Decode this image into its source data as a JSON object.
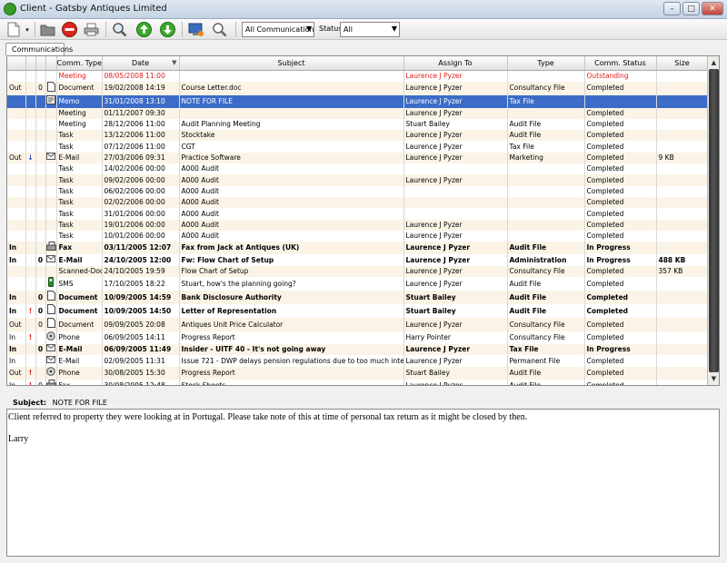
{
  "window": {
    "title": "Client - Gatsby Antiques Limited"
  },
  "toolbar": {
    "filter_value": "All Communications",
    "status_label": "Status",
    "status_value": "All"
  },
  "tabs": [
    {
      "label": "Communications"
    }
  ],
  "grid": {
    "columns": [
      "",
      "",
      "",
      "",
      "Comm. Type",
      "Date",
      "Subject",
      "Assign To",
      "Type",
      "Comm. Status",
      "Size"
    ],
    "rows": [
      {
        "dir": "",
        "flag": "",
        "att": "",
        "icon": "",
        "ctype": "Meeting",
        "date": "08/05/2008 11:00",
        "subject": "",
        "assign": "Laurence J Pyzer",
        "type": "",
        "status": "Outstanding",
        "size": "",
        "style": "red"
      },
      {
        "dir": "Out",
        "flag": "",
        "att": "0",
        "icon": "doc",
        "ctype": "Document",
        "date": "19/02/2008 14:19",
        "subject": "Course Letter.doc",
        "assign": "Laurence J Pyzer",
        "type": "Consultancy File",
        "status": "Completed",
        "size": "",
        "style": ""
      },
      {
        "dir": "",
        "flag": "",
        "att": "",
        "icon": "memo",
        "ctype": "Memo",
        "date": "31/01/2008 13:10",
        "subject": "NOTE FOR FILE",
        "assign": "Laurence J Pyzer",
        "type": "Tax File",
        "status": "",
        "size": "",
        "style": "selected"
      },
      {
        "dir": "",
        "flag": "",
        "att": "",
        "icon": "",
        "ctype": "Meeting",
        "date": "01/11/2007 09:30",
        "subject": "",
        "assign": "Laurence J Pyzer",
        "type": "",
        "status": "Completed",
        "size": "",
        "style": ""
      },
      {
        "dir": "",
        "flag": "",
        "att": "",
        "icon": "",
        "ctype": "Meeting",
        "date": "28/12/2006 11:00",
        "subject": "Audit Planning Meeting",
        "assign": "Stuart Bailey",
        "type": "Audit File",
        "status": "Completed",
        "size": "",
        "style": ""
      },
      {
        "dir": "",
        "flag": "",
        "att": "",
        "icon": "",
        "ctype": "Task",
        "date": "13/12/2006 11:00",
        "subject": "Stocktake",
        "assign": "Laurence J Pyzer",
        "type": "Audit File",
        "status": "Completed",
        "size": "",
        "style": ""
      },
      {
        "dir": "",
        "flag": "",
        "att": "",
        "icon": "",
        "ctype": "Task",
        "date": "07/12/2006 11:00",
        "subject": "CGT",
        "assign": "Laurence J Pyzer",
        "type": "Tax File",
        "status": "Completed",
        "size": "",
        "style": ""
      },
      {
        "dir": "Out",
        "flag": "↓",
        "att": "",
        "icon": "mail",
        "ctype": "E-Mail",
        "date": "27/03/2006 09:31",
        "subject": "Practice Software",
        "assign": "Laurence J Pyzer",
        "type": "Marketing",
        "status": "Completed",
        "size": "9 KB",
        "style": ""
      },
      {
        "dir": "",
        "flag": "",
        "att": "",
        "icon": "",
        "ctype": "Task",
        "date": "14/02/2006 00:00",
        "subject": "A000    Audit",
        "assign": "",
        "type": "",
        "status": "Completed",
        "size": "",
        "style": ""
      },
      {
        "dir": "",
        "flag": "",
        "att": "",
        "icon": "",
        "ctype": "Task",
        "date": "09/02/2006 00:00",
        "subject": "A000    Audit",
        "assign": "Laurence J Pyzer",
        "type": "",
        "status": "Completed",
        "size": "",
        "style": ""
      },
      {
        "dir": "",
        "flag": "",
        "att": "",
        "icon": "",
        "ctype": "Task",
        "date": "06/02/2006 00:00",
        "subject": "A000    Audit",
        "assign": "",
        "type": "",
        "status": "Completed",
        "size": "",
        "style": ""
      },
      {
        "dir": "",
        "flag": "",
        "att": "",
        "icon": "",
        "ctype": "Task",
        "date": "02/02/2006 00:00",
        "subject": "A000    Audit",
        "assign": "",
        "type": "",
        "status": "Completed",
        "size": "",
        "style": ""
      },
      {
        "dir": "",
        "flag": "",
        "att": "",
        "icon": "",
        "ctype": "Task",
        "date": "31/01/2006 00:00",
        "subject": "A000    Audit",
        "assign": "",
        "type": "",
        "status": "Completed",
        "size": "",
        "style": ""
      },
      {
        "dir": "",
        "flag": "",
        "att": "",
        "icon": "",
        "ctype": "Task",
        "date": "19/01/2006 00:00",
        "subject": "A000    Audit",
        "assign": "Laurence J Pyzer",
        "type": "",
        "status": "Completed",
        "size": "",
        "style": ""
      },
      {
        "dir": "",
        "flag": "",
        "att": "",
        "icon": "",
        "ctype": "Task",
        "date": "10/01/2006 00:00",
        "subject": "A000    Audit",
        "assign": "Laurence J Pyzer",
        "type": "",
        "status": "Completed",
        "size": "",
        "style": ""
      },
      {
        "dir": "In",
        "flag": "",
        "att": "",
        "icon": "fax",
        "ctype": "Fax",
        "date": "03/11/2005 12:07",
        "subject": "Fax from Jack at Antiques (UK)",
        "assign": "Laurence J Pyzer",
        "type": "Audit File",
        "status": "In Progress",
        "size": "",
        "style": "bold"
      },
      {
        "dir": "In",
        "flag": "",
        "att": "0",
        "icon": "mail",
        "ctype": "E-Mail",
        "date": "24/10/2005 12:00",
        "subject": "Fw: Flow Chart of Setup",
        "assign": "Laurence J Pyzer",
        "type": "Administration",
        "status": "In Progress",
        "size": "488 KB",
        "style": "bold"
      },
      {
        "dir": "",
        "flag": "",
        "att": "",
        "icon": "",
        "ctype": "Scanned-Doc",
        "date": "24/10/2005 19:59",
        "subject": "Flow Chart of Setup",
        "assign": "Laurence J Pyzer",
        "type": "Consultancy File",
        "status": "Completed",
        "size": "357 KB",
        "style": ""
      },
      {
        "dir": "",
        "flag": "",
        "att": "",
        "icon": "sms",
        "ctype": "SMS",
        "date": "17/10/2005 18:22",
        "subject": "Stuart, how's the planning going?",
        "assign": "Laurence J Pyzer",
        "type": "Audit File",
        "status": "Completed",
        "size": "",
        "style": ""
      },
      {
        "dir": "In",
        "flag": "",
        "att": "0",
        "icon": "doc",
        "ctype": "Document",
        "date": "10/09/2005 14:59",
        "subject": "Bank Disclosure Authority",
        "assign": "Stuart Bailey",
        "type": "Audit File",
        "status": "Completed",
        "size": "",
        "style": "bold"
      },
      {
        "dir": "In",
        "flag": "!",
        "att": "0",
        "icon": "doc",
        "ctype": "Document",
        "date": "10/09/2005 14:50",
        "subject": "Letter of Representation",
        "assign": "Stuart Bailey",
        "type": "Audit File",
        "status": "Completed",
        "size": "",
        "style": "bold"
      },
      {
        "dir": "Out",
        "flag": "",
        "att": "0",
        "icon": "doc",
        "ctype": "Document",
        "date": "09/09/2005 20:08",
        "subject": "Antiques Unit Price Calculator",
        "assign": "Laurence J Pyzer",
        "type": "Consultancy File",
        "status": "Completed",
        "size": "",
        "style": ""
      },
      {
        "dir": "In",
        "flag": "!",
        "att": "",
        "icon": "phone",
        "ctype": "Phone",
        "date": "06/09/2005 14:11",
        "subject": "Progress Report",
        "assign": "Harry Pointer",
        "type": "Consultancy File",
        "status": "Completed",
        "size": "",
        "style": ""
      },
      {
        "dir": "In",
        "flag": "",
        "att": "0",
        "icon": "mail",
        "ctype": "E-Mail",
        "date": "06/09/2005 11:49",
        "subject": "Insider - UITF 40 - It's not going away",
        "assign": "Laurence J Pyzer",
        "type": "Tax File",
        "status": "In Progress",
        "size": "",
        "style": "bold"
      },
      {
        "dir": "In",
        "flag": "",
        "att": "",
        "icon": "mail",
        "ctype": "E-Mail",
        "date": "02/09/2005 11:31",
        "subject": "Issue 721 - DWP delays pension regulations due to too much interest",
        "assign": "Laurence J Pyzer",
        "type": "Permanent File",
        "status": "Completed",
        "size": "",
        "style": ""
      },
      {
        "dir": "Out",
        "flag": "!",
        "att": "",
        "icon": "phone",
        "ctype": "Phone",
        "date": "30/08/2005 15:30",
        "subject": "Progress Report",
        "assign": "Stuart Bailey",
        "type": "Audit File",
        "status": "Completed",
        "size": "",
        "style": ""
      },
      {
        "dir": "In",
        "flag": "!",
        "att": "0",
        "icon": "fax",
        "ctype": "Fax",
        "date": "30/08/2005 12:48",
        "subject": "Stock Sheets",
        "assign": "Laurence J Pyzer",
        "type": "Audit File",
        "status": "Completed",
        "size": "",
        "style": ""
      },
      {
        "dir": "Out",
        "flag": "",
        "att": "0",
        "icon": "doc",
        "ctype": "Document",
        "date": "26/07/2005 18:53",
        "subject": "Accounting for Antiques",
        "assign": "Laurence J Pyzer",
        "type": "Marketing",
        "status": "Completed",
        "size": "",
        "style": ""
      }
    ]
  },
  "detail": {
    "subject_label": "Subject:",
    "subject_value": "NOTE FOR FILE",
    "body_paragraphs": [
      "Client referred to property they were looking at in Portugal. Please take note of this at time of personal tax return as it might be closed by then.",
      "Larry"
    ]
  }
}
